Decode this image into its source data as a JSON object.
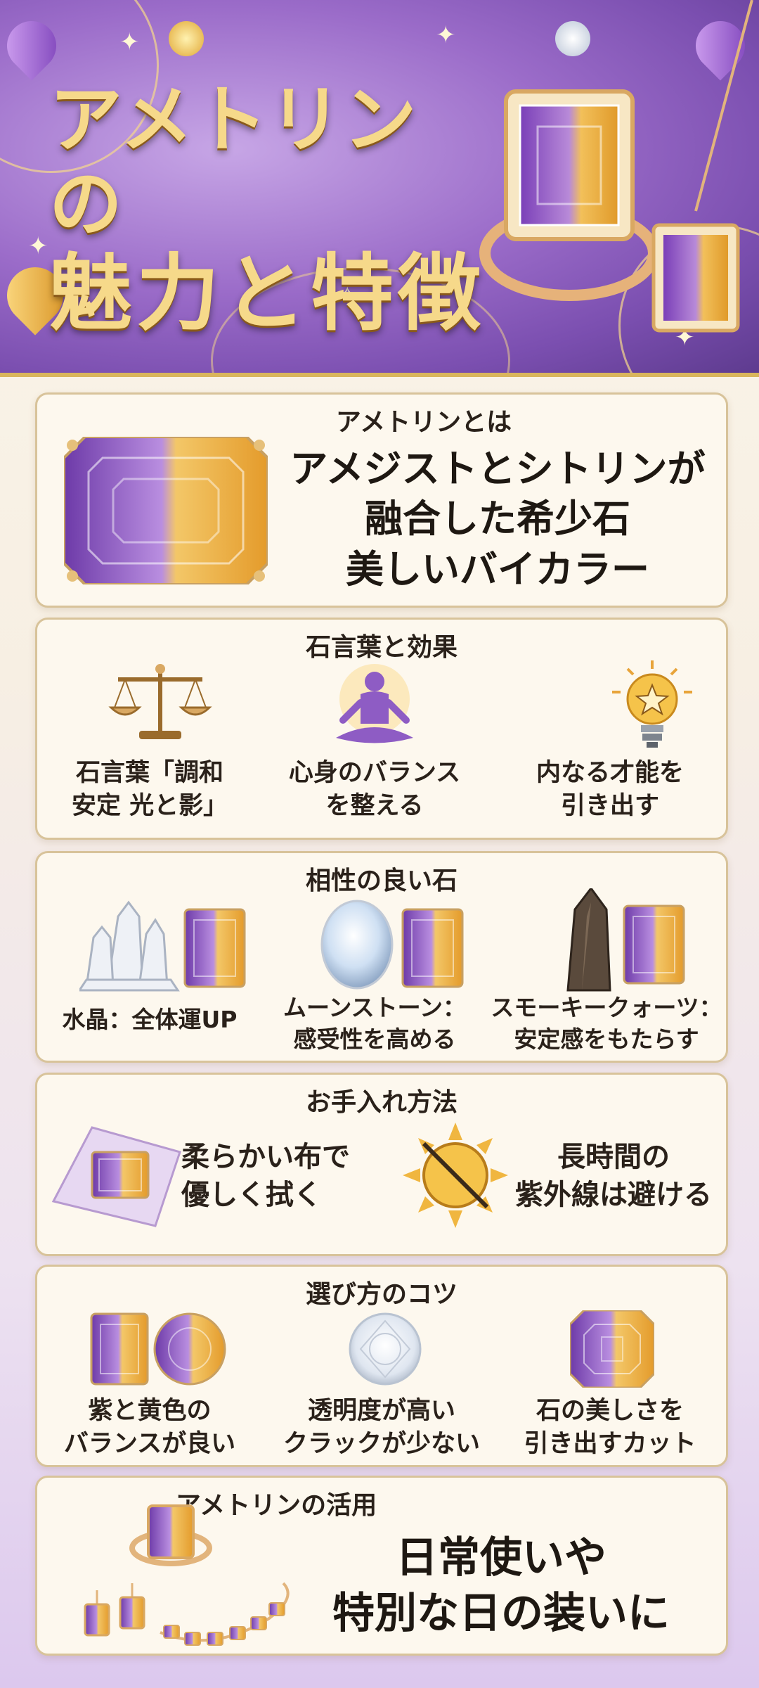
{
  "header": {
    "title_line1": "アメトリンの",
    "title_line2": "魅力と特徴"
  },
  "sections": {
    "about": {
      "title": "アメトリンとは",
      "text_line1": "アメジストとシトリンが",
      "text_line2": "融合した希少石",
      "text_line3": "美しいバイカラー"
    },
    "meaning": {
      "title": "石言葉と効果",
      "items": [
        {
          "icon": "scale-icon",
          "line1": "石言葉「調和",
          "line2": "安定 光と影」"
        },
        {
          "icon": "meditation-icon",
          "line1": "心身のバランス",
          "line2": "を整える"
        },
        {
          "icon": "lightbulb-icon",
          "line1": "内なる才能を",
          "line2": "引き出す"
        }
      ]
    },
    "compat": {
      "title": "相性の良い石",
      "items": [
        {
          "icon": "crystal-quartz-icon",
          "line1": "水晶：全体運UP",
          "line2": ""
        },
        {
          "icon": "moonstone-icon",
          "line1": "ムーンストーン：",
          "line2": "感受性を高める"
        },
        {
          "icon": "smoky-quartz-icon",
          "line1": "スモーキークォーツ：",
          "line2": "安定感をもたらす"
        }
      ]
    },
    "care": {
      "title": "お手入れ方法",
      "items": [
        {
          "icon": "cloth-icon",
          "line1": "柔らかい布で",
          "line2": "優しく拭く"
        },
        {
          "icon": "no-sun-icon",
          "line1": "長時間の",
          "line2": "紫外線は避ける"
        }
      ]
    },
    "choose": {
      "title": "選び方のコツ",
      "items": [
        {
          "icon": "bicolor-gem-icon",
          "line1": "紫と黄色の",
          "line2": "バランスが良い"
        },
        {
          "icon": "clear-diamond-icon",
          "line1": "透明度が高い",
          "line2": "クラックが少ない"
        },
        {
          "icon": "cut-gem-icon",
          "line1": "石の美しさを",
          "line2": "引き出すカット"
        }
      ]
    },
    "usage": {
      "title": "アメトリンの活用",
      "text_line1": "日常使いや",
      "text_line2": "特別な日の装いに"
    }
  },
  "colors": {
    "gold": "#d9b55c",
    "purple": "#8e5cc4",
    "yellow": "#f1b94a",
    "card_bg": "#fdf8ee",
    "card_border": "#d8c39a"
  }
}
